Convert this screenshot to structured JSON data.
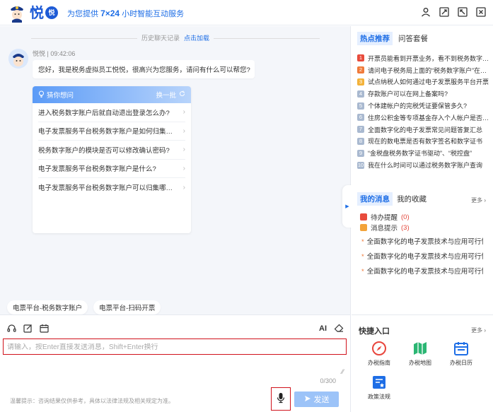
{
  "header": {
    "brand_char": "悦",
    "brand_badge": "悦",
    "slogan_prefix": "为您提供 ",
    "slogan_bold": "7×24",
    "slogan_suffix": " 小时智能互动服务"
  },
  "chat": {
    "history_label": "历史聊天记录",
    "history_load": "点击加载",
    "bot_meta": "悦悦 | 09:42:06",
    "bot_message": "您好，我是税务虚拟员工悦悦，很高兴为您服务，请问有什么可以帮您?",
    "guess": {
      "title": "猜你想问",
      "refresh": "换一批",
      "items": [
        "进入税务数字账户后就自动退出登录怎么办?",
        "电子发票服务平台税务数字账户是如何归集发票的?",
        "税务数字账户的模块是否可以修改确认密码?",
        "电子发票服务平台税务数字账户是什么?",
        "电子发票服务平台税务数字账户可以归集哪些发票?"
      ]
    },
    "chips": [
      "电票平台-税务数字账户",
      "电票平台-扫码开票"
    ]
  },
  "input": {
    "ai_label": "AI",
    "placeholder": "请输入，按Enter直接发送消息，Shift+Enter换行",
    "counter": "0/300",
    "tip": "温馨提示：咨询结果仅供参考，具体以法律法规及相关规定为准。",
    "send_label": "发送"
  },
  "right": {
    "hot_tab": "热点推荐",
    "qa_tab": "问答套餐",
    "hot_items": [
      {
        "rank": "1",
        "text": "开票员能看到开票业务，看不到税务数字账户",
        "color": "#e84b3c"
      },
      {
        "rank": "2",
        "text": "请问电子税务局上面的“税务数字账户”在哪里",
        "color": "#f07a3a"
      },
      {
        "rank": "3",
        "text": "试点纳税人如何通过电子发票服务平台开票",
        "color": "#f3b23a"
      },
      {
        "rank": "4",
        "text": "存款账户可以在网上备案吗?",
        "color": "#a9b9d0"
      },
      {
        "rank": "5",
        "text": "个体建帐户的完税凭证要保管多久?",
        "color": "#a9b9d0"
      },
      {
        "rank": "6",
        "text": "住房公积金等专项基金存入个人帐户是否缴税",
        "color": "#a9b9d0"
      },
      {
        "rank": "7",
        "text": "全面数字化的电子发票常见问题答复汇总",
        "color": "#a9b9d0"
      },
      {
        "rank": "8",
        "text": "现在的数电票是否有数字签名和数字证书",
        "color": "#a9b9d0"
      },
      {
        "rank": "9",
        "text": "“金税盘税务数字证书驱动”、“税控盘”",
        "color": "#a9b9d0"
      },
      {
        "rank": "10",
        "text": "我在什么时间可以通过税务数字账户查询",
        "color": "#a9b9d0"
      }
    ],
    "msg_tab": "我的消息",
    "fav_tab": "我的收藏",
    "more": "更多",
    "pending_label": "待办提醒",
    "pending_count": "(0)",
    "notice_label": "消息提示",
    "notice_count": "(3)",
    "news": [
      "全面数字化的电子发票技术与应用可行性研究",
      "全面数字化的电子发票技术与应用可行性研究",
      "全面数字化的电子发票技术与应用可行性研究"
    ],
    "quick_title": "快捷入口",
    "quick_items": [
      "办税指南",
      "办税地图",
      "办税日历",
      "政策法规"
    ]
  }
}
